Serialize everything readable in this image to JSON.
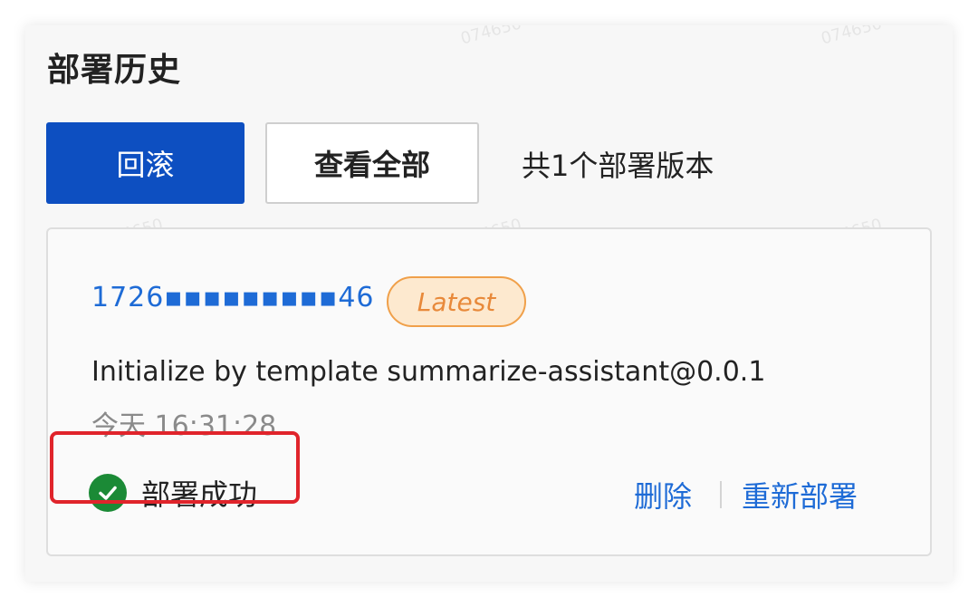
{
  "header": {
    "title": "部署历史"
  },
  "toolbar": {
    "rollback_label": "回滚",
    "view_all_label": "查看全部",
    "count_text": "共1个部署版本"
  },
  "deployment": {
    "version_id": "1726▪▪▪▪▪▪▪▪▪46",
    "badge": "Latest",
    "description": "Initialize by template summarize-assistant@0.0.1",
    "timestamp": "今天 16:31:28",
    "status": {
      "label": "部署成功",
      "icon": "check-circle-icon"
    },
    "actions": {
      "delete_label": "删除",
      "redeploy_label": "重新部署"
    }
  },
  "watermark": "074650",
  "colors": {
    "primary": "#0d4fc1",
    "link": "#1e6bd6",
    "success": "#1b8a36",
    "badge_bg": "#fde9cf",
    "badge_border": "#f0a04a",
    "highlight": "#e0242b"
  }
}
